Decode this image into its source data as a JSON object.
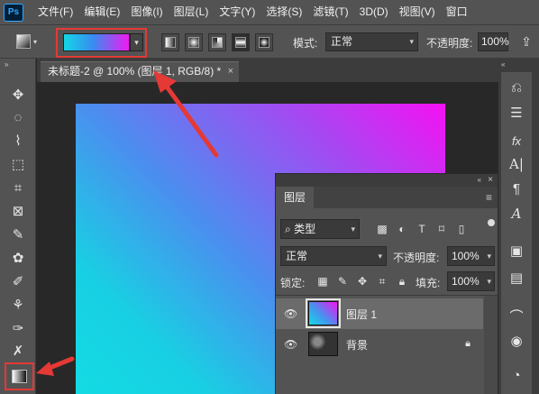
{
  "menubar": {
    "logo": "Ps",
    "items": [
      "文件(F)",
      "编辑(E)",
      "图像(I)",
      "图层(L)",
      "文字(Y)",
      "选择(S)",
      "滤镜(T)",
      "3D(D)",
      "视图(V)",
      "窗口"
    ]
  },
  "options": {
    "gradient_colors": [
      "#12d7e6",
      "#ef1bf2"
    ],
    "mode_label": "模式:",
    "mode_value": "正常",
    "opacity_label": "不透明度:",
    "opacity_value": "100%"
  },
  "document_tab": {
    "title": "未标题-2 @ 100% (图层 1, RGB/8) *",
    "close": "×"
  },
  "layers_panel": {
    "tab_label": "图层",
    "filter_value": "类型",
    "blend_mode": "正常",
    "opacity_label": "不透明度:",
    "opacity_value": "100%",
    "lock_label": "锁定:",
    "fill_label": "填充:",
    "fill_value": "100%",
    "layers": [
      {
        "name": "图层 1",
        "selected": true
      },
      {
        "name": "背景",
        "locked": true
      }
    ]
  },
  "annotation_color": "#e53935"
}
